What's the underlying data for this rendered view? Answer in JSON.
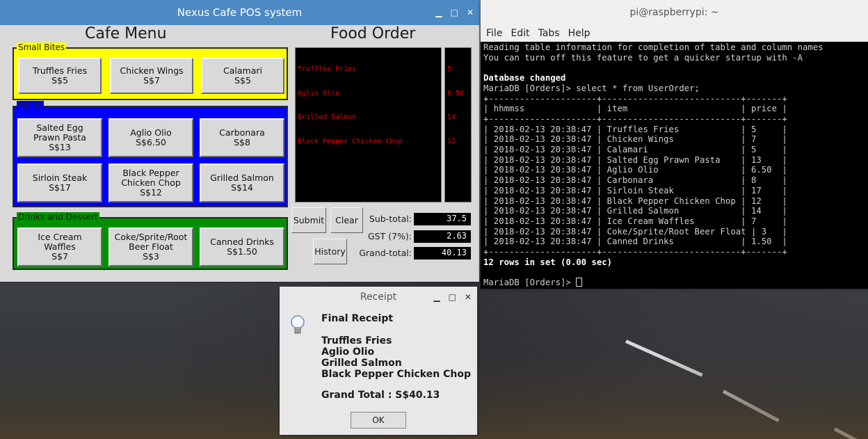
{
  "pos_window": {
    "title": "Nexus Cafe POS system",
    "menu_heading": "Cafe Menu",
    "order_heading": "Food Order",
    "groups": {
      "small_bites": "Small Bites",
      "mains": "Mains",
      "drinks": "Drinks and Dessert"
    },
    "items": {
      "truffles": [
        "Truffles Fries",
        "S$5"
      ],
      "wings": [
        "Chicken Wings",
        "S$7"
      ],
      "calamari": [
        "Calamari",
        "S$5"
      ],
      "salted_egg": [
        "Salted Egg",
        "Prawn Pasta",
        "S$13"
      ],
      "aglio": [
        "Aglio Olio",
        "S$6.50"
      ],
      "carbonara": [
        "Carbonara",
        "S$8"
      ],
      "sirloin": [
        "Sirloin Steak",
        "S$17"
      ],
      "black_pepper": [
        "Black Pepper",
        "Chicken Chop",
        "S$12"
      ],
      "salmon": [
        "Grilled Salmon",
        "S$14"
      ],
      "waffles": [
        "Ice Cream",
        "Waffles",
        "S$7"
      ],
      "coke": [
        "Coke/Sprite/Root",
        "Beer Float",
        "S$3"
      ],
      "canned": [
        "Canned Drinks",
        "S$1.50"
      ]
    },
    "order_items": [
      "Truffles Fries",
      "Aglio Olio",
      "Grilled Salmon",
      "Black Pepper Chicken Chop"
    ],
    "order_prices": [
      "5",
      "6.50",
      "14",
      "12"
    ],
    "buttons": {
      "submit": "Submit",
      "clear": "Clear",
      "history": "History"
    },
    "totals": {
      "subtotal_label": "Sub-total:",
      "subtotal": "37.5",
      "gst_label": "GST (7%):",
      "gst": "2.63",
      "grand_label": "Grand-total:",
      "grand": "40.13"
    }
  },
  "terminal": {
    "title": "pi@raspberrypi: ~",
    "menu": [
      "File",
      "Edit",
      "Tabs",
      "Help"
    ],
    "lines_top": [
      "Reading table information for completion of table and column names",
      "You can turn off this feature to get a quicker startup with -A",
      ""
    ],
    "db_changed": "Database changed",
    "prompt_query": "MariaDB [Orders]> select * from UserOrder;",
    "table_border": "+---------------------+---------------------------+-------+",
    "table_header": "| hhmmss              | item                      | price |",
    "rows": [
      "| 2018-02-13 20:38:47 | Truffles Fries            | 5     |",
      "| 2018-02-13 20:38:47 | Chicken Wings             | 7     |",
      "| 2018-02-13 20:38:47 | Calamari                  | 5     |",
      "| 2018-02-13 20:38:47 | Salted Egg Prawn Pasta    | 13    |",
      "| 2018-02-13 20:38:47 | Aglio Olio                | 6.50  |",
      "| 2018-02-13 20:38:47 | Carbonara                 | 8     |",
      "| 2018-02-13 20:38:47 | Sirloin Steak             | 17    |",
      "| 2018-02-13 20:38:47 | Black Pepper Chicken Chop | 12    |",
      "| 2018-02-13 20:38:47 | Grilled Salmon            | 14    |",
      "| 2018-02-13 20:38:47 | Ice Cream Waffles         | 7     |",
      "| 2018-02-13 20:38:47 | Coke/Sprite/Root Beer Float | 3   |",
      "| 2018-02-13 20:38:47 | Canned Drinks             | 1.50  |"
    ],
    "rows_in_set": "12 rows in set (0.00 sec)",
    "final_prompt": "MariaDB [Orders]> "
  },
  "receipt": {
    "title": "Receipt",
    "heading": "Final Receipt",
    "items": [
      "Truffles Fries",
      "Aglio Olio",
      "Grilled Salmon",
      "Black Pepper Chicken Chop"
    ],
    "grand_total": "Grand Total : S$40.13",
    "ok": "OK"
  },
  "icons": [
    "minimize-icon",
    "maximize-icon",
    "close-icon",
    "lightbulb-icon"
  ],
  "colors": {
    "title_blue": "#4d89c2",
    "small_bites": "#ffff00",
    "mains": "#0000ff",
    "drinks": "#009000",
    "order_text": "#e00000"
  }
}
